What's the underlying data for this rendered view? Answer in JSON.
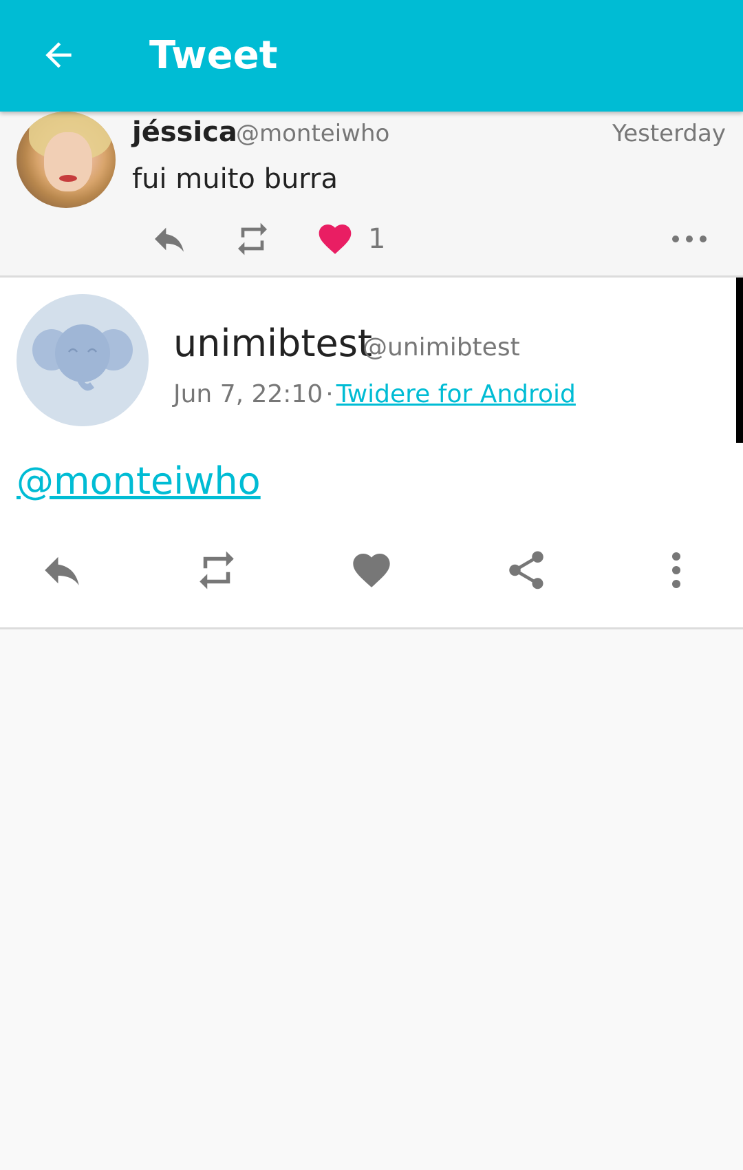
{
  "appbar": {
    "title": "Tweet",
    "back_icon": "arrow-left-icon",
    "color": "#00bcd4"
  },
  "parent_tweet": {
    "name": "jéssica",
    "handle": "@monteiwho",
    "time": "Yesterday",
    "text": "fui muito burra",
    "like_count": "1",
    "actions": [
      "reply-icon",
      "retweet-icon",
      "heart-icon",
      "more-horizontal-icon"
    ],
    "like_color": "#e91e63"
  },
  "main_tweet": {
    "name": "unimibtest",
    "handle": "@unimibtest",
    "date": "Jun 7, 22:10",
    "separator": "·",
    "source": "Twidere for Android",
    "text": "@monteiwho",
    "actions": [
      "reply-icon",
      "retweet-icon",
      "heart-icon",
      "share-icon",
      "more-vertical-icon"
    ]
  }
}
